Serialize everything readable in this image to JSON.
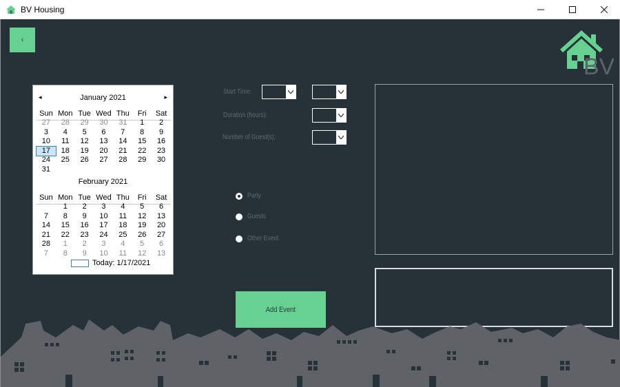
{
  "window": {
    "title": "BV Housing"
  },
  "back_button": {
    "label": "‹"
  },
  "logo": {
    "text": "BV"
  },
  "calendar": {
    "months": [
      {
        "title": "January 2021",
        "weekdays": [
          "Sun",
          "Mon",
          "Tue",
          "Wed",
          "Thu",
          "Fri",
          "Sat"
        ],
        "weeks": [
          [
            "27",
            "28",
            "29",
            "30",
            "31",
            "1",
            "2"
          ],
          [
            "3",
            "4",
            "5",
            "6",
            "7",
            "8",
            "9"
          ],
          [
            "10",
            "11",
            "12",
            "13",
            "14",
            "15",
            "16"
          ],
          [
            "17",
            "18",
            "19",
            "20",
            "21",
            "22",
            "23"
          ],
          [
            "24",
            "25",
            "26",
            "27",
            "28",
            "29",
            "30"
          ],
          [
            "31",
            "",
            "",
            "",
            "",
            "",
            ""
          ]
        ]
      },
      {
        "title": "February 2021",
        "weekdays": [
          "Sun",
          "Mon",
          "Tue",
          "Wed",
          "Thu",
          "Fri",
          "Sat"
        ],
        "weeks": [
          [
            "",
            "1",
            "2",
            "3",
            "4",
            "5",
            "6"
          ],
          [
            "7",
            "8",
            "9",
            "10",
            "11",
            "12",
            "13"
          ],
          [
            "14",
            "15",
            "16",
            "17",
            "18",
            "19",
            "20"
          ],
          [
            "21",
            "22",
            "23",
            "24",
            "25",
            "26",
            "27"
          ],
          [
            "28",
            "1",
            "2",
            "3",
            "4",
            "5",
            "6"
          ],
          [
            "7",
            "8",
            "9",
            "10",
            "11",
            "12",
            "13"
          ]
        ]
      }
    ],
    "selected_date": "17",
    "today_label": "Today: 1/17/2021"
  },
  "form": {
    "start_time_label": "Start Time:",
    "start_separator": ":",
    "duration_label": "Duration (hours):",
    "guests_label": "Number of Guest(s):"
  },
  "event_types": [
    {
      "label": "Party",
      "checked": true
    },
    {
      "label": "Guests",
      "checked": false
    },
    {
      "label": "Other Event",
      "checked": false
    }
  ],
  "add_event_button": {
    "label": "Add Event"
  },
  "colors": {
    "background": "#263238",
    "accent": "#67d192",
    "skyline": "#5f6368"
  }
}
